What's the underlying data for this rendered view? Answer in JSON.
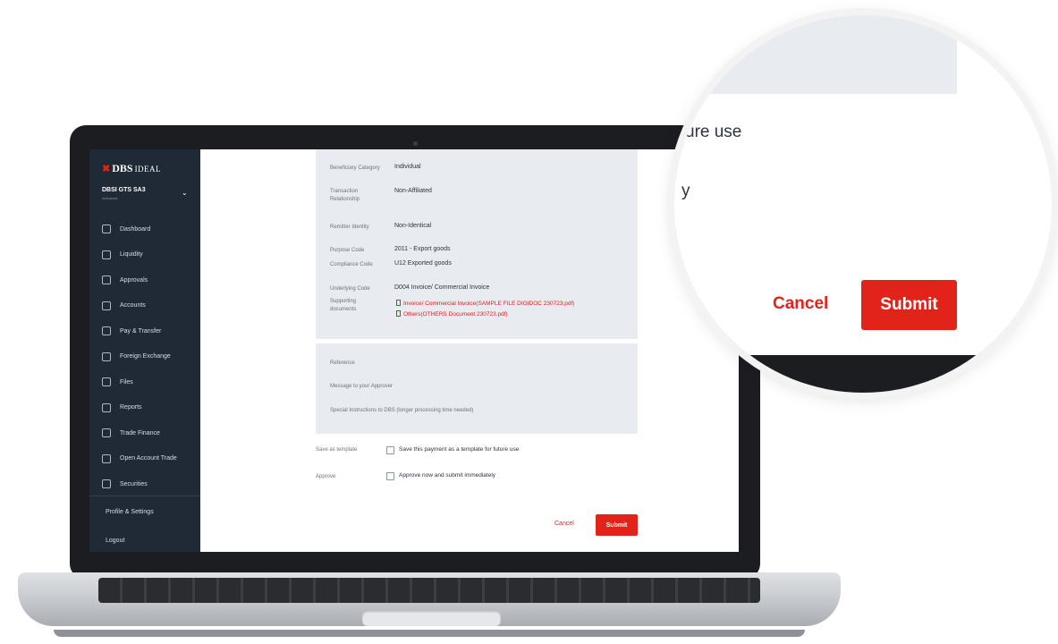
{
  "brand": {
    "name": "DBS",
    "product": "IDEAL"
  },
  "account": {
    "name": "DBSI GTS SA3",
    "country": "Indonesia"
  },
  "sidebar": {
    "items": [
      {
        "label": "Dashboard",
        "icon": "home-icon"
      },
      {
        "label": "Liquidity",
        "icon": "liquidity-icon"
      },
      {
        "label": "Approvals",
        "icon": "approvals-icon"
      },
      {
        "label": "Accounts",
        "icon": "accounts-icon"
      },
      {
        "label": "Pay & Transfer",
        "icon": "pay-transfer-icon"
      },
      {
        "label": "Foreign Exchange",
        "icon": "foreign-exchange-icon"
      },
      {
        "label": "Files",
        "icon": "files-icon"
      },
      {
        "label": "Reports",
        "icon": "reports-icon"
      },
      {
        "label": "Trade Finance",
        "icon": "trade-finance-icon"
      },
      {
        "label": "Open Account Trade",
        "icon": "open-account-trade-icon"
      },
      {
        "label": "Securities",
        "icon": "securities-icon"
      }
    ],
    "profile": "Profile & Settings",
    "logout": "Logout"
  },
  "details": {
    "beneficiary_category": {
      "label": "Beneficiary Category",
      "value": "Individual"
    },
    "transaction_relationship": {
      "label": "Transaction Relationship",
      "value": "Non-Affiliated"
    },
    "remitter_identity": {
      "label": "Remitter Identity",
      "value": "Non-Identical"
    },
    "purpose_code": {
      "label": "Purpose Code",
      "value": "2011 - Export goods"
    },
    "compliance_code": {
      "label": "Compliance Code",
      "value": "U12 Exported goods"
    },
    "underlying_code": {
      "label": "Underlying Code",
      "value": "D004 Invoice/ Commercial Invoice"
    },
    "supporting_documents": {
      "label": "Supporting documents",
      "files": [
        "Invoice/ Commercial Invoice(SAMPLE FILE DIGIDOC 230723.pdf)",
        "Others(OTHERS Document 230723.pdf)"
      ]
    }
  },
  "notes": {
    "reference": "Reference",
    "message": "Message to your Approver",
    "special": "Special Instructions to DBS (longer processing time needed)"
  },
  "options": {
    "template_label": "Save as template",
    "template_text": "Save this payment as a template for future use",
    "approve_label": "Approve",
    "approve_text": "Approve now and submit immediately"
  },
  "actions": {
    "cancel": "Cancel",
    "submit": "Submit"
  },
  "magnified": {
    "line1": "ure use",
    "line2": "y",
    "cancel": "Cancel",
    "submit": "Submit"
  }
}
